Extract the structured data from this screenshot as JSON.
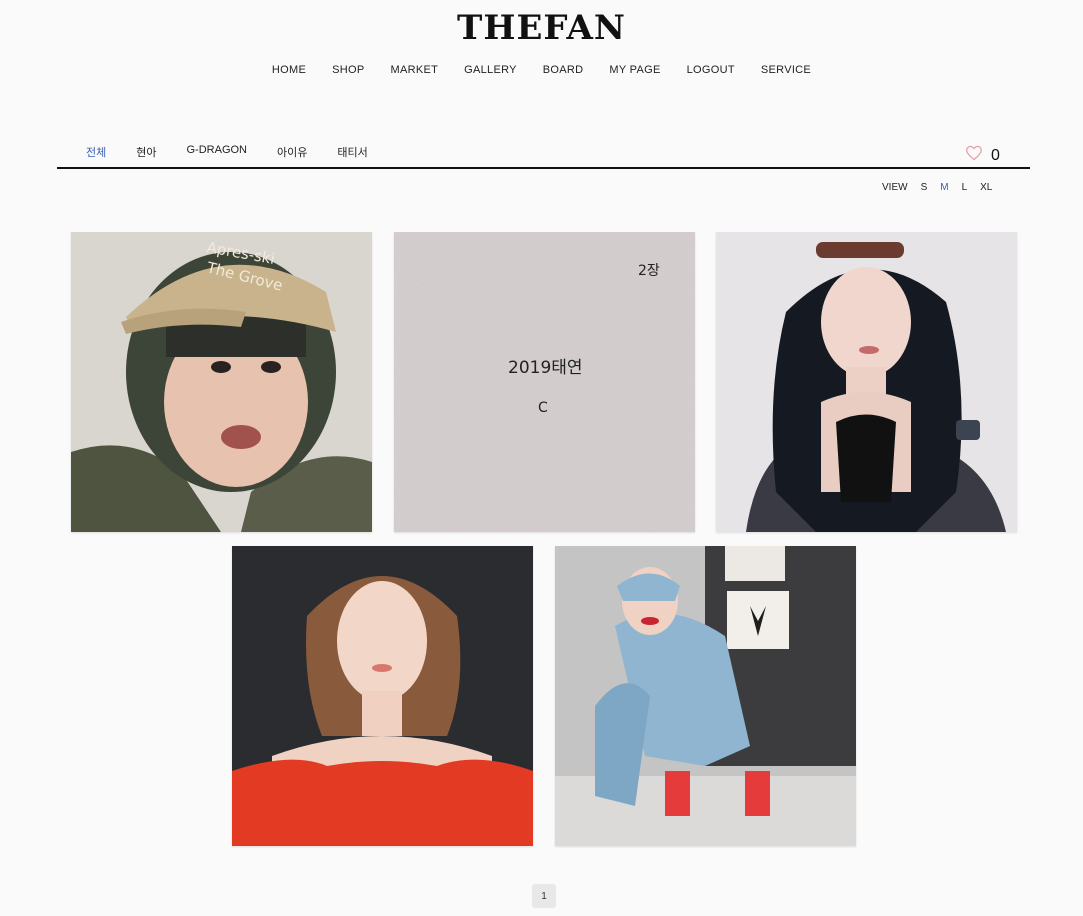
{
  "brand": {
    "logo": "THEFAN"
  },
  "nav": [
    "HOME",
    "SHOP",
    "MARKET",
    "GALLERY",
    "BOARD",
    "MY PAGE",
    "LOGOUT",
    "SERVICE"
  ],
  "tabs": [
    {
      "label": "전체",
      "active": true
    },
    {
      "label": "현아",
      "active": false
    },
    {
      "label": "G-DRAGON",
      "active": false
    },
    {
      "label": "아이유",
      "active": false
    },
    {
      "label": "태티서",
      "active": false
    }
  ],
  "likes": {
    "count": "0",
    "icon": "heart-outline-icon",
    "color": "#e39aa6"
  },
  "view": {
    "label": "VIEW",
    "options": [
      "S",
      "M",
      "L",
      "XL"
    ],
    "selected": "M"
  },
  "gallery": {
    "items": [
      {
        "name": "photo-cap-girl"
      },
      {
        "name": "text-card",
        "lines": {
          "top": "2장",
          "middle": "2019태연",
          "bottom": "C"
        }
      },
      {
        "name": "photo-black-hair"
      },
      {
        "name": "photo-red-dress"
      },
      {
        "name": "photo-denim-jacket"
      }
    ]
  },
  "pagination": {
    "current": "1"
  },
  "colors": {
    "accent": "#3a5fb0",
    "divider": "#111111"
  }
}
